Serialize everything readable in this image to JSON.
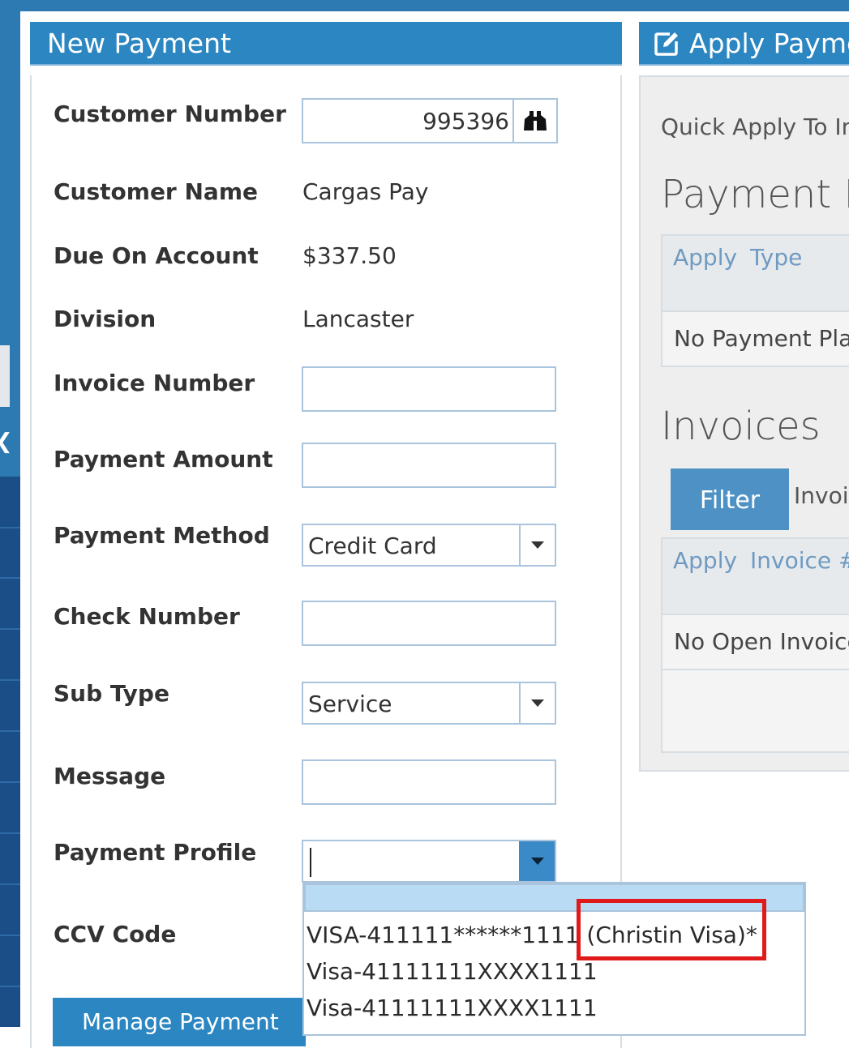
{
  "left_panel": {
    "title": "New Payment",
    "fields": {
      "customer_number": {
        "label": "Customer Number",
        "value": "995396"
      },
      "customer_name": {
        "label": "Customer Name",
        "value": "Cargas Pay"
      },
      "due_on_account": {
        "label": "Due On Account",
        "value": "$337.50"
      },
      "division": {
        "label": "Division",
        "value": "Lancaster"
      },
      "invoice_number": {
        "label": "Invoice Number",
        "value": ""
      },
      "payment_amount": {
        "label": "Payment Amount",
        "value": ""
      },
      "payment_method": {
        "label": "Payment Method",
        "value": "Credit Card"
      },
      "check_number": {
        "label": "Check Number",
        "value": ""
      },
      "sub_type": {
        "label": "Sub Type",
        "value": "Service"
      },
      "message": {
        "label": "Message",
        "value": ""
      },
      "payment_profile": {
        "label": "Payment Profile",
        "value": ""
      },
      "ccv_code": {
        "label": "CCV Code",
        "value": ""
      }
    },
    "payment_profile_options": [
      "",
      "VISA-411111******1111 (Christin Visa)*",
      "Visa-41111111XXXX1111",
      "Visa-41111111XXXX1111"
    ],
    "bottom_button_label": "Manage Payment"
  },
  "right_panel": {
    "title": "Apply Payme",
    "quick_apply": "Quick Apply To In",
    "payment_plans": {
      "title": "Payment P",
      "columns": [
        "Apply",
        "Type"
      ],
      "empty_text": "No Payment Pla"
    },
    "invoices": {
      "title": "Invoices",
      "filter_label": "Filter",
      "search_label": "Invoi",
      "columns": [
        "Apply",
        "Invoice #"
      ],
      "empty_text": "No Open Invoice"
    }
  },
  "colors": {
    "header_blue": "#2b86c1",
    "highlight_red": "#e01a1a",
    "selected_option": "#b9dbf4"
  },
  "icons": {
    "lookup": "binoculars-icon",
    "apply_header": "edit-icon",
    "dropdown": "caret-down-icon"
  }
}
